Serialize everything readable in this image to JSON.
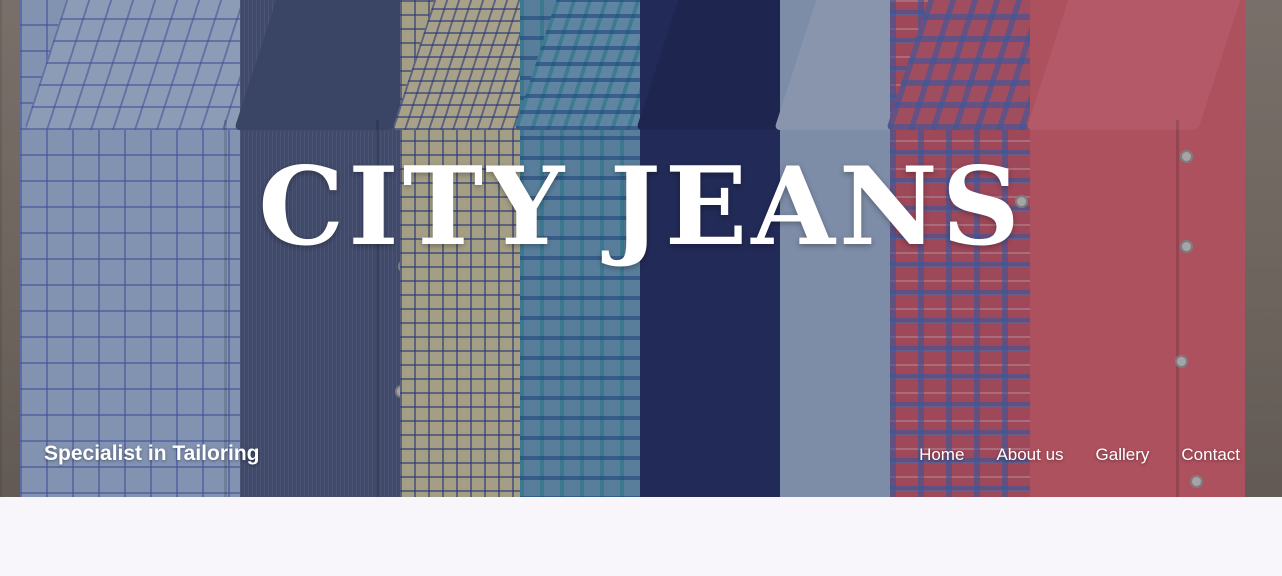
{
  "hero": {
    "title": "CITY JEANS",
    "tagline": "Specialist in Tailoring"
  },
  "nav": {
    "items": [
      {
        "label": "Home"
      },
      {
        "label": "About us"
      },
      {
        "label": "Gallery"
      },
      {
        "label": "Contact"
      }
    ]
  },
  "colors": {
    "text": "#ffffff",
    "page_background": "#f8f6fa"
  }
}
